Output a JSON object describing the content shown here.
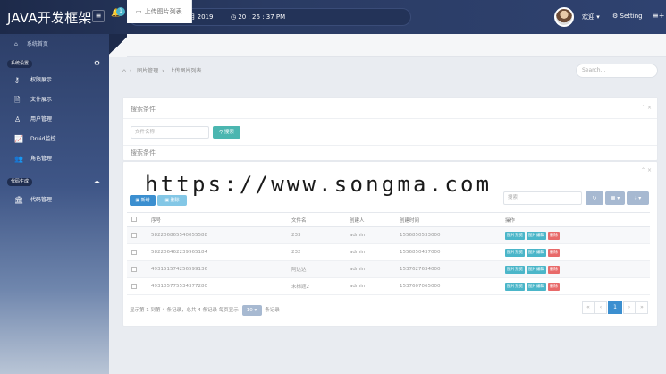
{
  "app": {
    "title": "JAVA开发框架",
    "notify_count": "1"
  },
  "topbar": {
    "date": "星期天, 26 五月 2019",
    "time": "20 : 26 : 37 PM",
    "welcome": "欢迎",
    "setting": "Setting"
  },
  "sidebar": {
    "home": "系统首页",
    "groups": [
      {
        "label": "系统设置",
        "items": [
          "权限展示",
          "文件展示",
          "用户管理",
          "Druid监控",
          "角色管理"
        ]
      },
      {
        "label": "代码生成",
        "items": [
          "代码管理"
        ]
      }
    ]
  },
  "tabs": [
    {
      "label": "上传图片列表"
    }
  ],
  "breadcrumb": {
    "items": [
      "图片管理",
      "上传图片列表"
    ],
    "search_placeholder": "Search..."
  },
  "search_panel": {
    "title": "搜索条件",
    "file_placeholder": "文件名称",
    "search_button": "搜索",
    "subtitle": "搜索条件"
  },
  "toolbar": {
    "add": "新增",
    "delete": "删除",
    "search_placeholder": "搜索"
  },
  "table": {
    "columns": [
      "序号",
      "文件名",
      "创建人",
      "创建时间",
      "操作"
    ],
    "rows": [
      [
        "582206865540055588",
        "233",
        "admin",
        "1556850533000"
      ],
      [
        "582206462239965184",
        "232",
        "admin",
        "1556850437000"
      ],
      [
        "493151574256599136",
        "阿达达",
        "admin",
        "1537627634000"
      ],
      [
        "493105775534377280",
        "未标题2",
        "admin",
        "1537607065000"
      ]
    ],
    "actions": {
      "preview": "图片预览",
      "edit": "图片编辑",
      "delete": "删除"
    }
  },
  "pagination": {
    "info_prefix": "显示第 1 到第 4 条记录，总共 4 条记录 每页显示",
    "page_size": "10",
    "info_suffix": "条记录",
    "first": "«",
    "prev": "‹",
    "current": "1",
    "next": "›",
    "last": "»"
  },
  "watermark": "https://www.songma.com"
}
